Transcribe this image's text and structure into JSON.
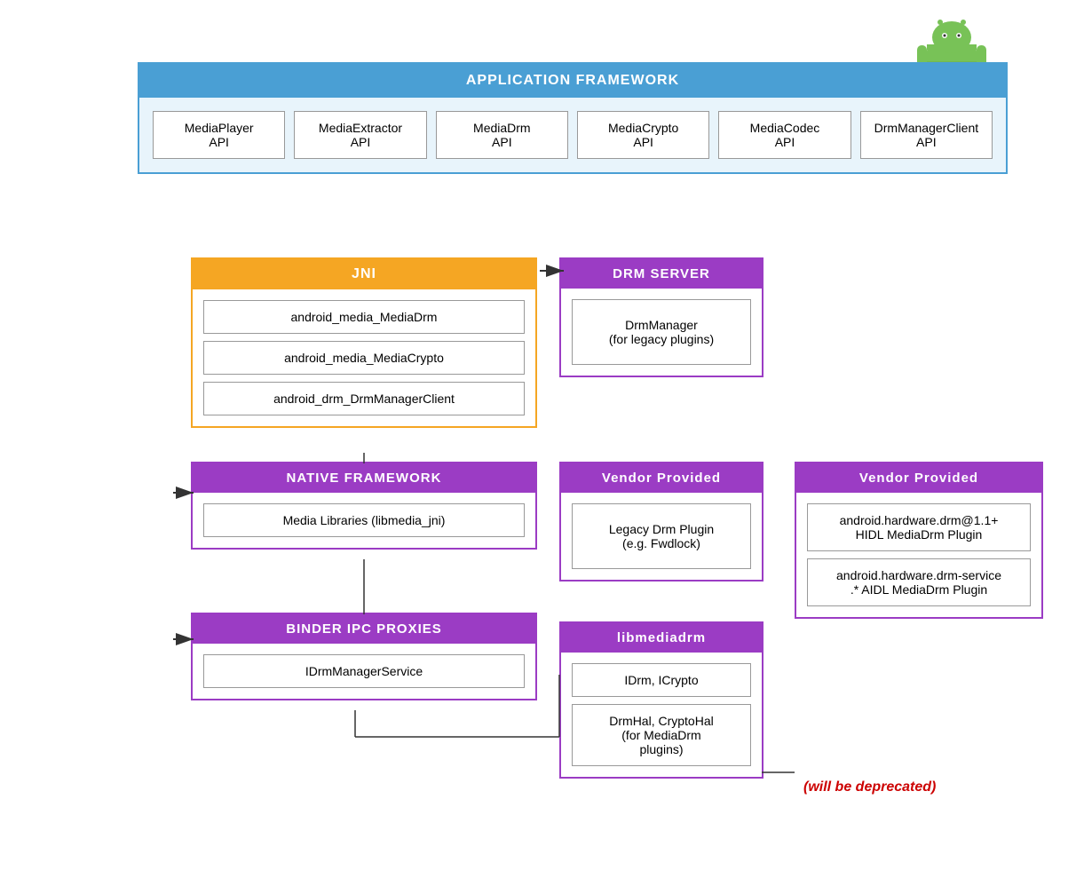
{
  "app_framework": {
    "header": "APPLICATION FRAMEWORK",
    "apis": [
      "MediaPlayer\nAPI",
      "MediaExtractor\nAPI",
      "MediaDrm\nAPI",
      "MediaCrypto\nAPI",
      "MediaCodec\nAPI",
      "DrmManagerClient\nAPI"
    ]
  },
  "jni": {
    "header": "JNI",
    "items": [
      "android_media_MediaDrm",
      "android_media_MediaCrypto",
      "android_drm_DrmManagerClient"
    ]
  },
  "native_framework": {
    "header": "NATIVE FRAMEWORK",
    "items": [
      "Media Libraries (libmedia_jni)"
    ]
  },
  "binder_ipc": {
    "header": "BINDER IPC PROXIES",
    "items": [
      "IDrmManagerService"
    ]
  },
  "drm_server": {
    "header": "DRM SERVER",
    "items": [
      "DrmManager\n(for legacy plugins)"
    ]
  },
  "vendor_left": {
    "header": "Vendor Provided",
    "items": [
      "Legacy Drm Plugin\n(e.g. Fwdlock)"
    ]
  },
  "vendor_right": {
    "header": "Vendor Provided",
    "items": [
      "android.hardware.drm@1.1+\nHIDL MediaDrm Plugin",
      "android.hardware.drm-service\n.* AIDL MediaDrm Plugin"
    ]
  },
  "libmediadrm": {
    "header": "libmediadrm",
    "items": [
      "IDrm, ICrypto",
      "DrmHal, CryptoHal\n(for MediaDrm\nplugins)"
    ]
  },
  "deprecated": "(will be deprecated)"
}
